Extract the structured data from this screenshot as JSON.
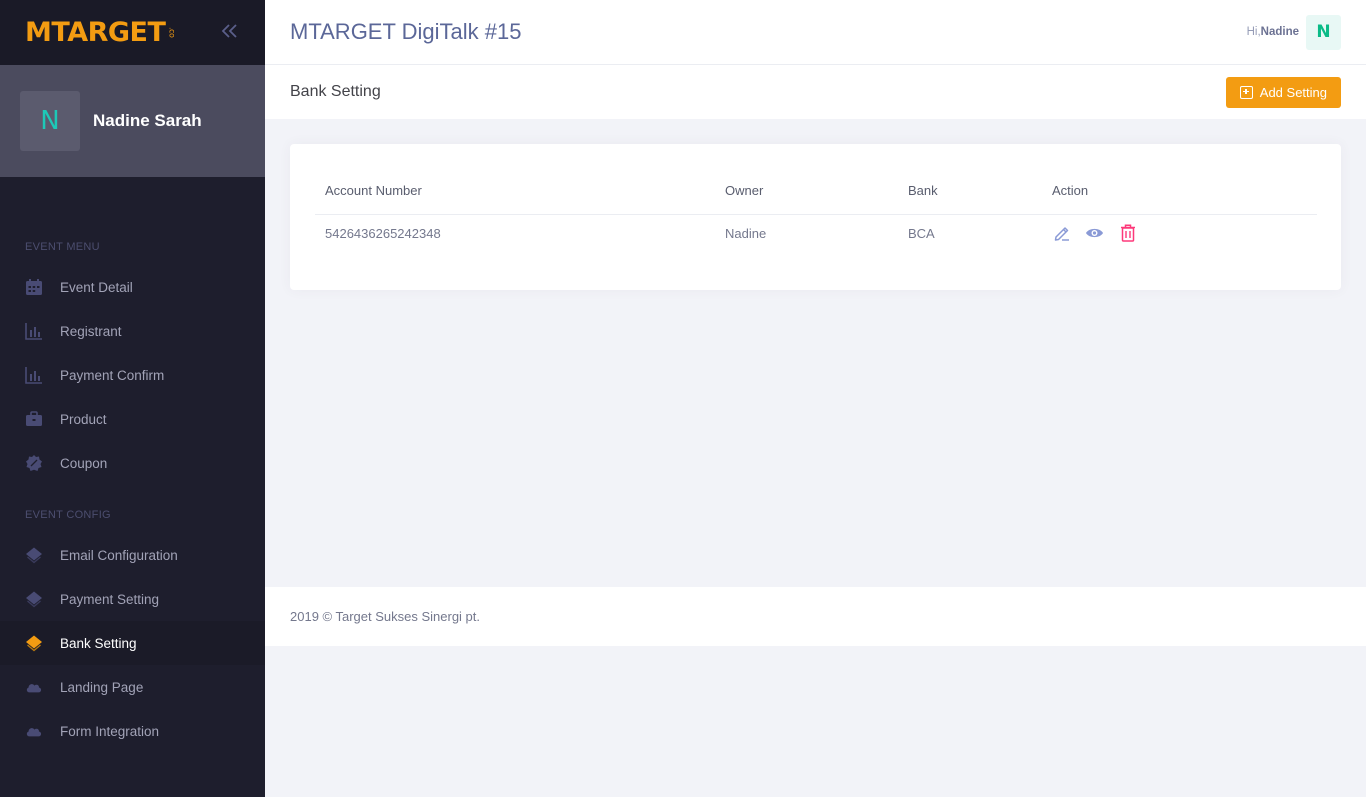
{
  "brand": {
    "logo_text_1": "MTARGET",
    "logo_suffix": ".co",
    "collapse_icon": "chevron-double-left-icon"
  },
  "user": {
    "avatar_letter": "N",
    "name": "Nadine Sarah"
  },
  "sidebar": {
    "sections": [
      {
        "title": "EVENT MENU",
        "items": [
          {
            "label": "Event Detail",
            "icon": "calendar-icon"
          },
          {
            "label": "Registrant",
            "icon": "bar-chart-icon"
          },
          {
            "label": "Payment Confirm",
            "icon": "bar-chart-icon"
          },
          {
            "label": "Product",
            "icon": "briefcase-icon"
          },
          {
            "label": "Coupon",
            "icon": "badge-icon"
          }
        ]
      },
      {
        "title": "EVENT CONFIG",
        "items": [
          {
            "label": "Email Configuration",
            "icon": "layers-icon"
          },
          {
            "label": "Payment Setting",
            "icon": "layers-icon"
          },
          {
            "label": "Bank Setting",
            "icon": "layers-icon",
            "active": true
          },
          {
            "label": "Landing Page",
            "icon": "cloud-icon"
          },
          {
            "label": "Form Integration",
            "icon": "cloud-icon"
          }
        ]
      }
    ]
  },
  "header": {
    "title": "MTARGET DigiTalk #15",
    "greeting": "Hi,",
    "user_name": "Nadine",
    "avatar_letter": "N"
  },
  "subheader": {
    "title": "Bank Setting",
    "add_button_label": "Add Setting"
  },
  "table": {
    "columns": [
      "Account Number",
      "Owner",
      "Bank",
      "Action"
    ],
    "rows": [
      {
        "account_number": "5426436265242348",
        "owner": "Nadine",
        "bank": "BCA"
      }
    ]
  },
  "footer": {
    "text": "2019 © Target Sukses Sinergi pt."
  },
  "colors": {
    "accent": "#f39c12",
    "sidebar_bg": "#1e1e2d",
    "danger": "#fd397a",
    "icon_primary": "#8a9ad6",
    "success": "#0abb87"
  }
}
